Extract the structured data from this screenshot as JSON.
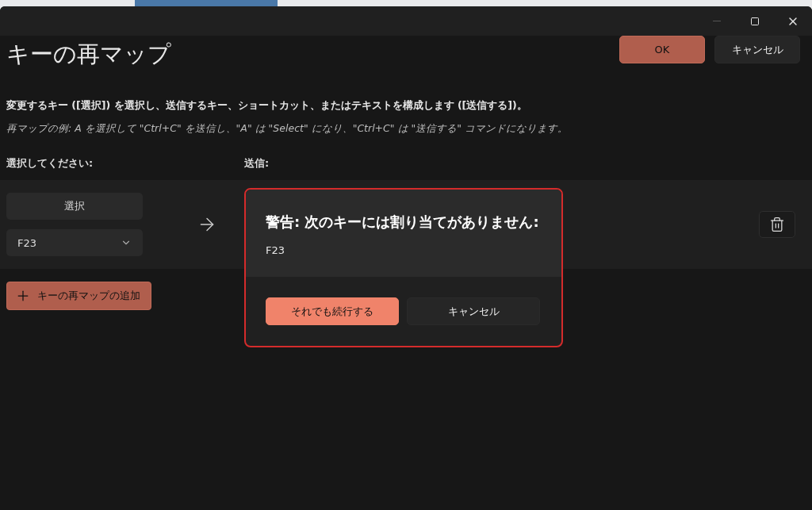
{
  "window": {
    "title": "キーの再マップ",
    "buttons": [
      {
        "label": "OK",
        "kind": "primary"
      },
      {
        "label": "キャンセル",
        "kind": "secondary"
      }
    ]
  },
  "description": {
    "instruction": "変更するキー ([選択]) を選択し、送信するキー、ショートカット、またはテキストを構成します ([送信する])。",
    "example": "再マップの例: A を選択して \"Ctrl+C\" を送信し、\"A\" は \"Select\" になり、\"Ctrl+C\" は \"送信する\" コマンドになります。"
  },
  "columns": {
    "select": "選択してください:",
    "send": "送信:"
  },
  "mapping": {
    "select_button": "選択",
    "key": "F23"
  },
  "add_button": "キーの再マップの追加",
  "dialog": {
    "title": "警告: 次のキーには割り当てがありません:",
    "key": "F23",
    "buttons": [
      {
        "label": "それでも続行する",
        "kind": "primary"
      },
      {
        "label": "キャンセル",
        "kind": "secondary"
      }
    ]
  }
}
